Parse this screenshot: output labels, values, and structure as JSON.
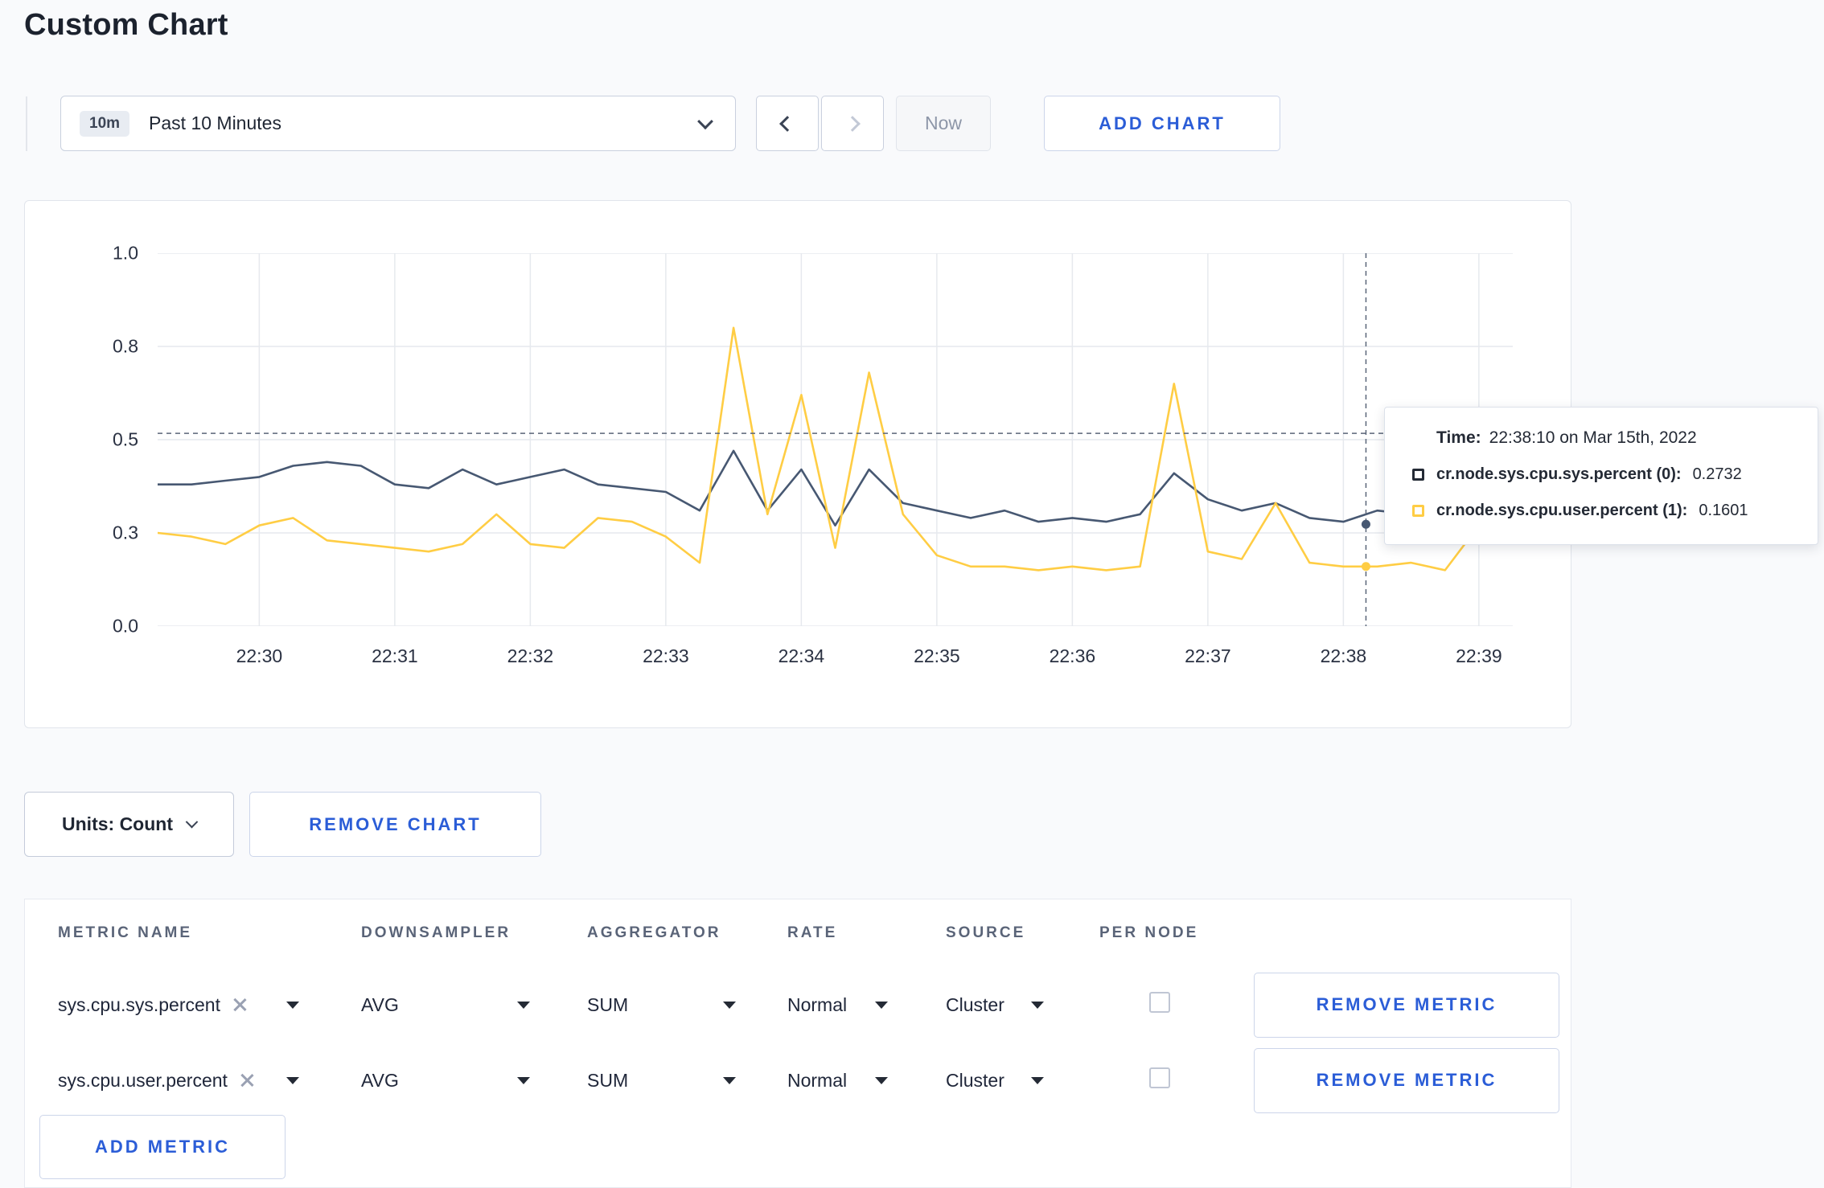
{
  "page": {
    "title": "Custom Chart",
    "background": "#f9fafc",
    "accent": "#2b5dd7"
  },
  "toolbar": {
    "range_badge": "10m",
    "range_label": "Past 10 Minutes",
    "now_label": "Now",
    "add_chart_label": "ADD CHART"
  },
  "chart_data": {
    "type": "line",
    "title": "",
    "x_start_time": "22:29:15",
    "interval_seconds": 15,
    "total_seconds": 600,
    "ylim": [
      0,
      1
    ],
    "grid": true,
    "y_ticks": [
      {
        "label": "0.0",
        "value": 0
      },
      {
        "label": "0.3",
        "value": 0.25
      },
      {
        "label": "0.5",
        "value": 0.5
      },
      {
        "label": "0.8",
        "value": 0.75
      },
      {
        "label": "1.0",
        "value": 1
      }
    ],
    "x_ticks": [
      "22:30",
      "22:31",
      "22:32",
      "22:33",
      "22:34",
      "22:35",
      "22:36",
      "22:37",
      "22:38",
      "22:39"
    ],
    "tick_start_seconds": 45,
    "tick_step_seconds": 60,
    "series": [
      {
        "name": "cr.node.sys.cpu.sys.percent",
        "color": "#475872",
        "values": [
          0.38,
          0.38,
          0.39,
          0.4,
          0.43,
          0.44,
          0.43,
          0.38,
          0.37,
          0.42,
          0.38,
          0.4,
          0.42,
          0.38,
          0.37,
          0.36,
          0.31,
          0.47,
          0.31,
          0.42,
          0.27,
          0.42,
          0.33,
          0.31,
          0.29,
          0.31,
          0.28,
          0.29,
          0.28,
          0.3,
          0.41,
          0.34,
          0.31,
          0.33,
          0.29,
          0.28,
          0.31,
          0.3,
          0.3,
          0.31,
          0.31
        ]
      },
      {
        "name": "cr.node.sys.cpu.user.percent",
        "color": "#ffcd44",
        "values": [
          0.25,
          0.24,
          0.22,
          0.27,
          0.29,
          0.23,
          0.22,
          0.21,
          0.2,
          0.22,
          0.3,
          0.22,
          0.21,
          0.29,
          0.28,
          0.24,
          0.17,
          0.8,
          0.3,
          0.62,
          0.21,
          0.68,
          0.3,
          0.19,
          0.16,
          0.16,
          0.15,
          0.16,
          0.15,
          0.16,
          0.65,
          0.2,
          0.18,
          0.33,
          0.17,
          0.16,
          0.16,
          0.17,
          0.15,
          0.27,
          0.24
        ]
      }
    ],
    "crosshair": {
      "time": "22:38:10",
      "seconds_from_start": 535,
      "hover_value": 0.517,
      "values": [
        0.2732,
        0.1601
      ]
    }
  },
  "tooltip": {
    "time_label": "Time:",
    "time_value": "22:38:10 on Mar 15th, 2022",
    "rows": [
      {
        "label": "cr.node.sys.cpu.sys.percent (0):",
        "value": "0.2732",
        "color": "#242a35"
      },
      {
        "label": "cr.node.sys.cpu.user.percent (1):",
        "value": "0.1601",
        "color": "#ffcd44"
      }
    ]
  },
  "chart_footer": {
    "units_label": "Units: Count",
    "remove_chart_label": "REMOVE CHART"
  },
  "metrics_table": {
    "headers": [
      "METRIC NAME",
      "DOWNSAMPLER",
      "AGGREGATOR",
      "RATE",
      "SOURCE",
      "PER NODE"
    ],
    "rows": [
      {
        "metric": "sys.cpu.sys.percent",
        "downsampler": "AVG",
        "aggregator": "SUM",
        "rate": "Normal",
        "source": "Cluster",
        "per_node": false,
        "remove_label": "REMOVE METRIC"
      },
      {
        "metric": "sys.cpu.user.percent",
        "downsampler": "AVG",
        "aggregator": "SUM",
        "rate": "Normal",
        "source": "Cluster",
        "per_node": false,
        "remove_label": "REMOVE METRIC"
      }
    ],
    "add_metric_label": "ADD METRIC"
  }
}
